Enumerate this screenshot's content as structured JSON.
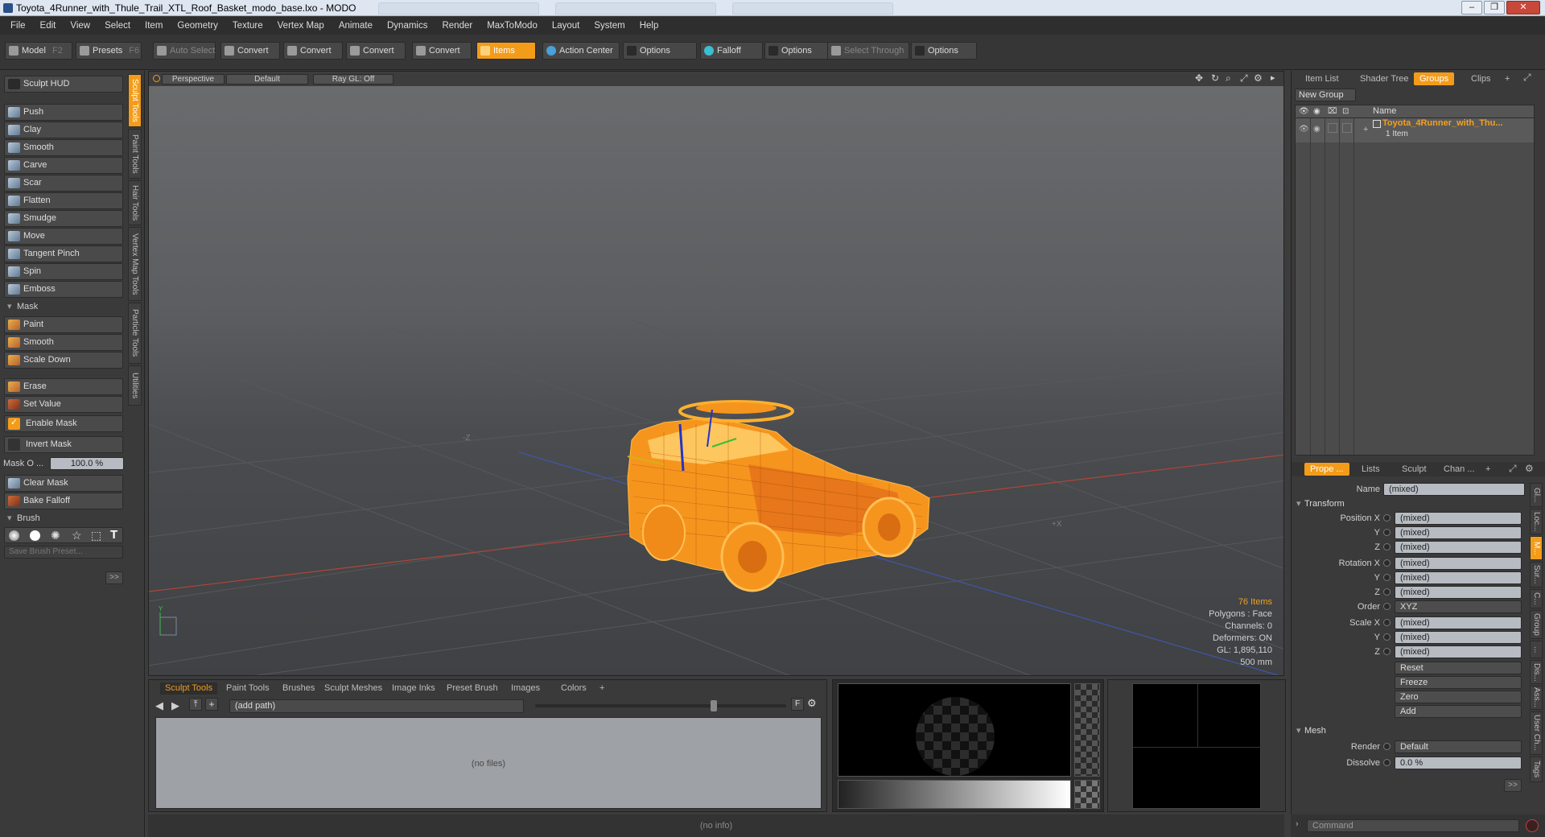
{
  "window": {
    "title": "Toyota_4Runner_with_Thule_Trail_XTL_Roof_Basket_modo_base.lxo - MODO",
    "controls": [
      "–",
      "❐",
      "✕"
    ]
  },
  "menubar": [
    "File",
    "Edit",
    "View",
    "Select",
    "Item",
    "Geometry",
    "Texture",
    "Vertex Map",
    "Animate",
    "Dynamics",
    "Render",
    "MaxToModo",
    "Layout",
    "System",
    "Help"
  ],
  "toolbar": {
    "model": "Model",
    "model_key": "F2",
    "presets": "Presets",
    "presets_key": "F6",
    "auto_select": "Auto Select",
    "convert1": "Convert",
    "convert2": "Convert",
    "convert3": "Convert",
    "convert4": "Convert",
    "items": "Items",
    "action_center": "Action Center",
    "options1": "Options",
    "falloff": "Falloff",
    "options2": "Options",
    "select_through": "Select Through",
    "options3": "Options"
  },
  "left": {
    "sculpt_hud": "Sculpt HUD",
    "tools": [
      "Push",
      "Clay",
      "Smooth",
      "Carve",
      "Scar",
      "Flatten",
      "Smudge",
      "Move",
      "Tangent Pinch",
      "Spin",
      "Emboss"
    ],
    "mask_header": "Mask",
    "mask_tools": [
      "Paint",
      "Smooth",
      "Scale Down"
    ],
    "erase": "Erase",
    "set_value": "Set Value",
    "enable_mask": "Enable Mask",
    "invert_mask": "Invert Mask",
    "mask_opacity_label": "Mask O ...",
    "mask_opacity_value": "100.0 %",
    "clear_mask": "Clear Mask",
    "bake_falloff": "Bake Falloff",
    "brush_header": "Brush",
    "save_brush_preset": "Save Brush Preset...",
    "expand": ">>",
    "vtabs": [
      "Sculpt Tools",
      "Paint Tools",
      "Hair Tools",
      "Vertex Map Tools",
      "Particle Tools",
      "Utilities"
    ]
  },
  "viewport": {
    "view": "Perspective",
    "shading": "Default",
    "raygl": "Ray GL: Off",
    "axis_z": "-Z",
    "axis_x": "+X",
    "axis_y": "Y",
    "info": {
      "items": "76 Items",
      "polygons": "Polygons : Face",
      "channels": "Channels: 0",
      "deformers": "Deformers: ON",
      "gl": "GL: 1,895,110",
      "scale": "500 mm"
    }
  },
  "browser": {
    "tabs": [
      "Sculpt Tools",
      "Paint Tools",
      "Brushes",
      "Sculpt Meshes",
      "Image Inks",
      "Preset Brush",
      "Images",
      "Colors",
      "+"
    ],
    "path_placeholder": "(add path)",
    "empty": "(no files)",
    "f_btn": "F"
  },
  "status": {
    "info": "(no info)"
  },
  "right": {
    "top_tabs": [
      "Item List",
      "Shader Tree",
      "Groups",
      "Clips",
      "+"
    ],
    "new_group": "New Group",
    "name_col": "Name",
    "group_name": "Toyota_4Runner_with_Thu...",
    "group_count": "1 Item",
    "prop_tabs": [
      "Prope ...",
      "Lists",
      "Sculpt",
      "Chan ...",
      "+"
    ],
    "name_label": "Name",
    "name_value": "(mixed)",
    "transform": "Transform",
    "position_x": "Position X",
    "pos_y": "Y",
    "pos_z": "Z",
    "rotation_x": "Rotation X",
    "rot_y": "Y",
    "rot_z": "Z",
    "order_label": "Order",
    "order_value": "XYZ",
    "scale_x": "Scale X",
    "scl_y": "Y",
    "scl_z": "Z",
    "mixed": "(mixed)",
    "reset": "Reset",
    "freeze": "Freeze",
    "zero": "Zero",
    "add": "Add",
    "mesh": "Mesh",
    "render_label": "Render",
    "render_value": "Default",
    "dissolve_label": "Dissolve",
    "dissolve_value": "0.0 %",
    "expand": ">>",
    "vtabs": [
      "Gl...",
      "Loc...",
      "M...",
      "Sur...",
      "C...",
      "Group",
      "...",
      "Dis...",
      "Ass...",
      "User Ch...",
      "Tags"
    ],
    "command_placeholder": "Command"
  },
  "colors": {
    "accent": "#f39c1a",
    "mesh": "#ff9a1c"
  }
}
